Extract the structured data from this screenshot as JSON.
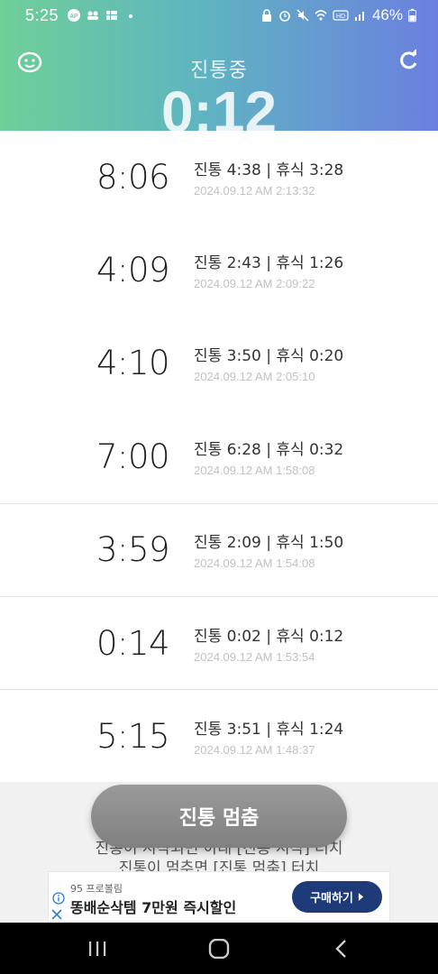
{
  "status_bar": {
    "time": "5:25",
    "battery": "46%",
    "left_icons": [
      "ap-icon",
      "people-icon",
      "grid-icon",
      "dot-icon"
    ],
    "right_icons": [
      "lock-icon",
      "alarm-icon",
      "mute-icon",
      "wifi-icon",
      "hd-icon",
      "signal-icon",
      "battery-icon"
    ]
  },
  "header": {
    "title": "진통중",
    "timer": "0:12",
    "left_icon": "face-icon",
    "right_icon": "refresh-icon"
  },
  "records": [
    {
      "total": "8:06",
      "summary": "진통 4:38 | 휴식 3:28",
      "date": "2024.09.12 AM 2:13:32"
    },
    {
      "total": "4:09",
      "summary": "진통 2:43 | 휴식 1:26",
      "date": "2024.09.12 AM 2:09:22"
    },
    {
      "total": "4:10",
      "summary": "진통 3:50 | 휴식 0:20",
      "date": "2024.09.12 AM 2:05:10"
    },
    {
      "total": "7:00",
      "summary": "진통 6:28 | 휴식 0:32",
      "date": "2024.09.12 AM 1:58:08"
    },
    {
      "total": "3:59",
      "summary": "진통 2:09 | 휴식 1:50",
      "date": "2024.09.12 AM 1:54:08"
    },
    {
      "total": "0:14",
      "summary": "진통 0:02 | 휴식 0:12",
      "date": "2024.09.12 AM 1:53:54"
    },
    {
      "total": "5:15",
      "summary": "진통 3:51 | 휴식 1:24",
      "date": "2024.09.12 AM 1:48:37"
    }
  ],
  "stop_button": "진통 멈춤",
  "hint_lines": [
    "진통이 시작되면 아래 [진통 시작] 터치",
    "진통이 멈추면 [진통 멈춤] 터치"
  ],
  "ad": {
    "brand": "95 프로볼림",
    "text": "똥배순삭템 7만원 즉시할인",
    "button": "구매하기"
  }
}
